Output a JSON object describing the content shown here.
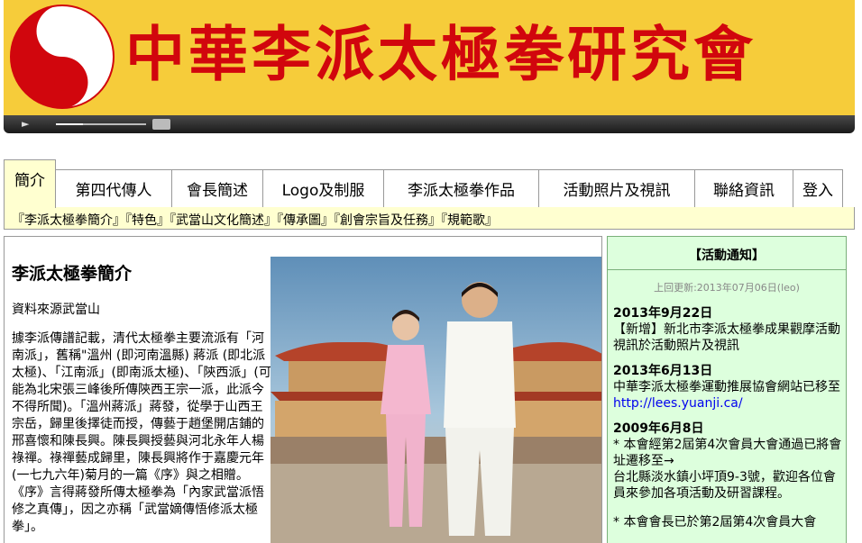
{
  "banner": {
    "title": "中華李派太極拳研究會",
    "logo_icon": "yin-yang-icon",
    "bg_color": "#f6cc3a",
    "title_color": "#d1060d"
  },
  "player": {
    "play_icon": "►",
    "progress": 0.3
  },
  "tabs": [
    {
      "label": "簡介",
      "active": true
    },
    {
      "label": "第四代傳人"
    },
    {
      "label": "會長簡述"
    },
    {
      "label": "Logo及制服"
    },
    {
      "label": "李派太極拳作品"
    },
    {
      "label": "活動照片及視訊"
    },
    {
      "label": "聯絡資訊"
    },
    {
      "label": "登入"
    }
  ],
  "subnav": [
    "『李派太極拳簡介』",
    "『特色』",
    "『武當山文化簡述』",
    "『傳承圖』",
    "『創會宗旨及任務』",
    "『規範歌』"
  ],
  "main": {
    "title": "李派太極拳簡介",
    "source": "資料來源武當山",
    "body": "據李派傳譜記載，清代太極拳主要流派有「河南派」，舊稱\"溫州 (即河南溫縣) 蔣派 (即北派太極)、「江南派」(即南派太極)、「陝西派」(可能為北宋張三峰後所傳陝西王宗一派，此派今不得所聞)。「溫州蔣派」蔣發，從學于山西王宗岳，歸里後擇徒而授，傳藝于趙堡開店鋪的邢喜懷和陳長興。陳長興授藝與河北永年人楊祿禪。祿禪藝成歸里，陳長興將作于嘉慶元年(一七九六年)菊月的一篇《序》與之相贈。《序》言得蔣發所傳太極拳為「內家武當派悟修之真傳」，因之亦稱「武當嫡傳悟修派太極拳」。"
  },
  "sidebar": {
    "title": "【活動通知】",
    "updated": "上回更新:2013年07月06日(leo)",
    "news": [
      {
        "date": "2013年9月22日",
        "text": "【新增】新北市李派太極拳成果觀摩活動視訊於活動照片及視訊"
      },
      {
        "date": "2013年6月13日",
        "text": "中華李派太極拳運動推展協會網站已移至 ",
        "link": "http://lees.yuanji.ca/"
      },
      {
        "date": "2009年6月8日",
        "text": "* 本會經第2屆第4次會員大會通過已將會址遷移至→\n台北縣淡水鎮小坪頂9-3號，歡迎各位會員來參加各項活動及研習課程。"
      },
      {
        "date": "",
        "text": "* 本會會長已於第2屆第4次會員大會"
      }
    ]
  }
}
